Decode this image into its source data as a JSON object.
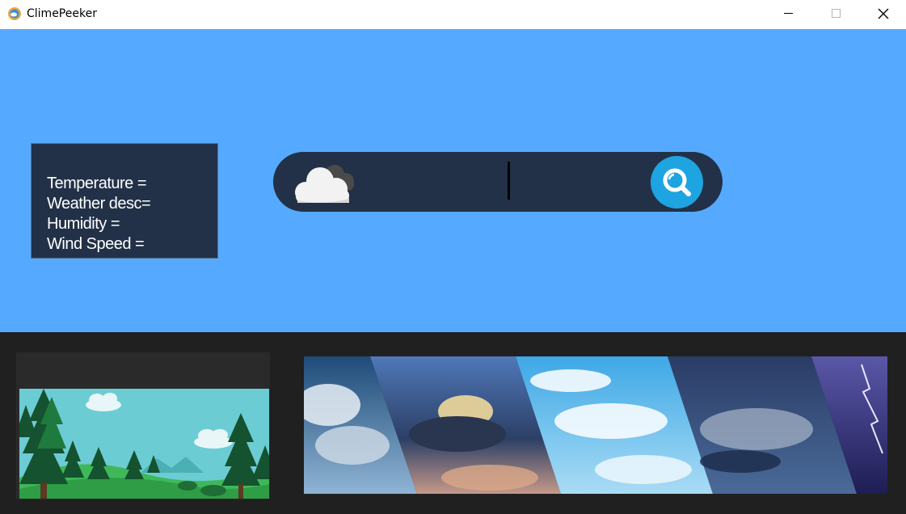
{
  "window": {
    "title": "ClimePeeker",
    "minimize_icon": "minimize-icon",
    "maximize_icon": "maximize-icon",
    "close_icon": "close-icon"
  },
  "info_panel": {
    "temperature_label": "Temperature =",
    "weather_desc_label": "Weather desc=",
    "humidity_label": "Humidity =",
    "wind_speed_label": "Wind Speed ="
  },
  "search": {
    "value": "",
    "placeholder": "",
    "weather_icon": "cloud-icon",
    "button_icon": "search-icon"
  },
  "images": {
    "landscape": "forest-landscape-illustration",
    "weather_strip": "weather-sky-collage"
  },
  "colors": {
    "top_background": "#55aaff",
    "panel_background": "#223147",
    "bottom_background": "#202020",
    "search_button": "#1ea4e0"
  }
}
